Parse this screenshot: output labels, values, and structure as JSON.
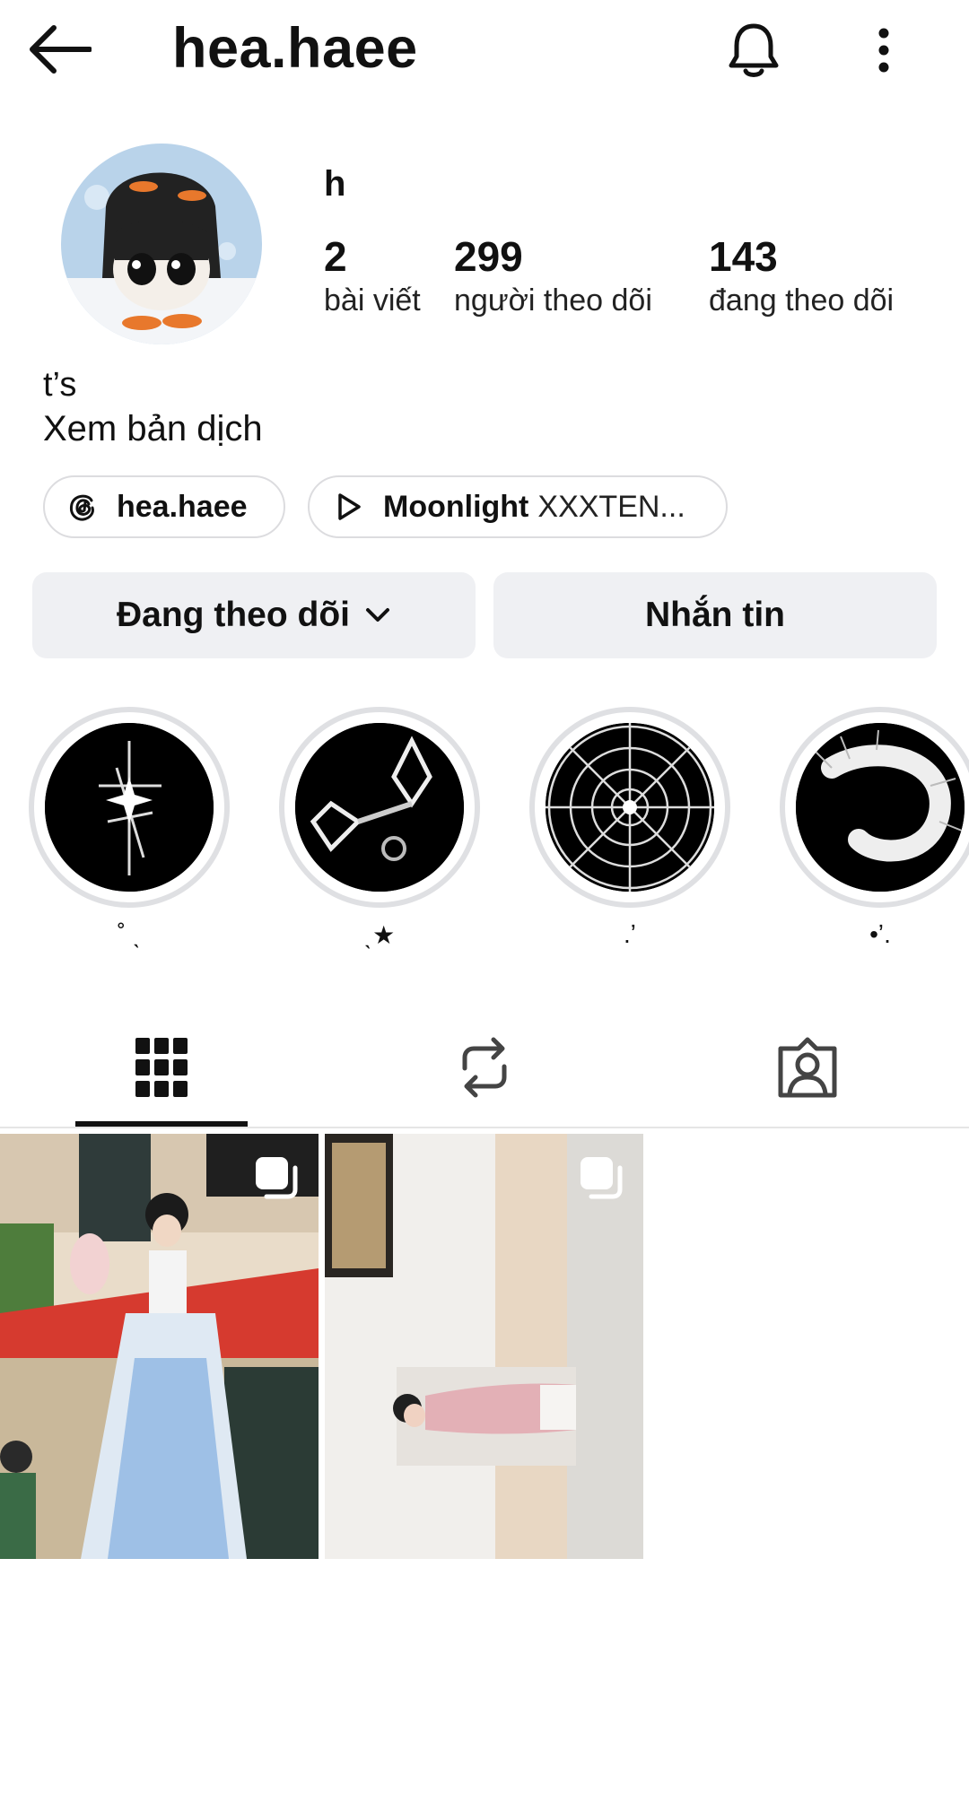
{
  "header": {
    "username": "hea.haee",
    "back_icon": "arrow-left-icon",
    "notification_icon": "bell-icon",
    "more_icon": "more-vertical-icon"
  },
  "profile": {
    "display_name": "h",
    "stats": [
      {
        "value": "2",
        "label": "bài viết"
      },
      {
        "value": "299",
        "label": "người theo dõi"
      },
      {
        "value": "143",
        "label": "đang theo dõi"
      }
    ],
    "bio": "t’s",
    "translate_label": "Xem bản dịch"
  },
  "chips": {
    "threads_label": "hea.haee",
    "music_title": "Moonlight",
    "music_artist": "XXXTEN..."
  },
  "actions": {
    "following_label": "Đang theo dõi",
    "message_label": "Nhắn tin"
  },
  "highlights": [
    {
      "caption": "˚ ˎ"
    },
    {
      "caption": "ˎ★"
    },
    {
      "caption": ".ʼ"
    },
    {
      "caption": "•ʼ."
    }
  ],
  "tabs": [
    "grid-icon",
    "repost-icon",
    "tagged-icon"
  ],
  "colors": {
    "button_bg": "#eff0f3",
    "text": "#111111",
    "highlight_ring": "#dfe0e3"
  }
}
